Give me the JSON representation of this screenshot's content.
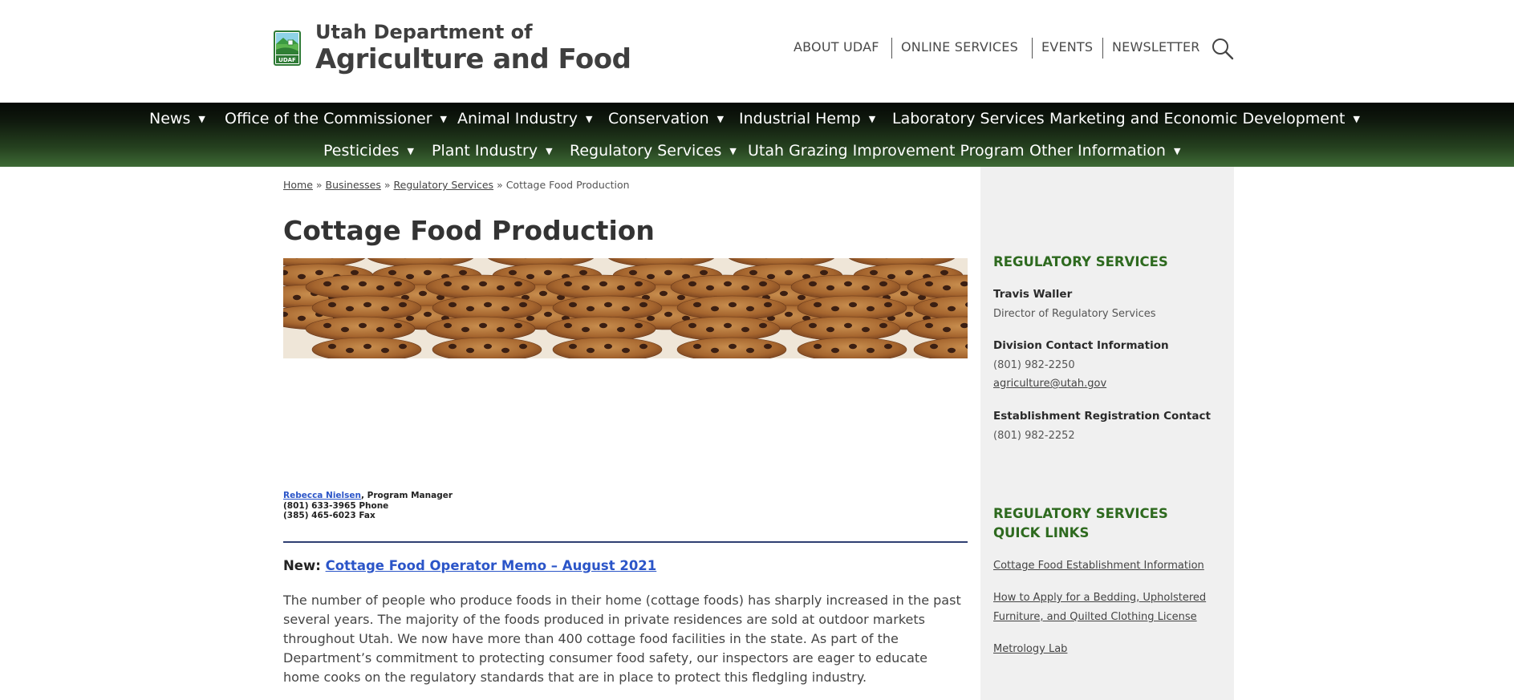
{
  "header": {
    "brand_line1": "Utah Department of",
    "brand_line2": "Agriculture and Food",
    "logo_text": "UDAF",
    "utility_links": [
      "ABOUT UDAF",
      "ONLINE SERVICES",
      "EVENTS",
      "NEWSLETTER"
    ],
    "search_icon": "magnifier"
  },
  "nav": {
    "row1": [
      {
        "label": "News",
        "has_dropdown": true
      },
      {
        "label": "Office of the Commissioner",
        "has_dropdown": true
      },
      {
        "label": "Animal Industry",
        "has_dropdown": true
      },
      {
        "label": "Conservation",
        "has_dropdown": true
      },
      {
        "label": "Industrial Hemp",
        "has_dropdown": true
      },
      {
        "label": "Laboratory Services",
        "has_dropdown": false
      },
      {
        "label": "Marketing and Economic Development",
        "has_dropdown": true
      }
    ],
    "row2": [
      {
        "label": "Pesticides",
        "has_dropdown": true
      },
      {
        "label": "Plant Industry",
        "has_dropdown": true
      },
      {
        "label": "Regulatory Services",
        "has_dropdown": true
      },
      {
        "label": "Utah Grazing Improvement Program",
        "has_dropdown": false
      },
      {
        "label": "Other Information",
        "has_dropdown": true
      }
    ],
    "caret": "▼"
  },
  "breadcrumb": {
    "home": "Home",
    "businesses": "Businesses",
    "regulatory": "Regulatory Services",
    "current": "Cottage Food Production",
    "separator": "»"
  },
  "page": {
    "title": "Cottage Food Production",
    "contact_name": "Rebecca Nielsen",
    "contact_role": ", Program Manager",
    "contact_phone": "(801) 633-3965 Phone",
    "contact_fax": "(385) 465-6023 Fax",
    "memo_prefix": "New:",
    "memo_link": "Cottage Food Operator Memo – August 2021",
    "intro": "The number of people who produce foods in their home (cottage foods) has sharply increased in the past several years. The majority of the foods produced in private residences are sold at outdoor markets throughout Utah. We now have more than 400 cottage food facilities in the state. As part of the Department’s commitment to protecting consumer food safety, our inspectors are eager to educate home cooks on the regulatory standards that are in place to protect this fledgling industry."
  },
  "sidebar": {
    "heading": "REGULATORY SERVICES",
    "director_name": "Travis Waller",
    "director_title": "Director of Regulatory Services",
    "division_label": "Division Contact Information",
    "division_phone": "(801) 982-2250",
    "division_email": "agriculture@utah.gov",
    "registration_label": "Establishment Registration Contact",
    "registration_phone": "(801) 982-2252",
    "quick_links_heading_1": "REGULATORY SERVICES",
    "quick_links_heading_2": "QUICK LINKS",
    "quick_links": [
      "Cottage Food Establishment Information",
      "How to Apply for a Bedding, Upholstered",
      "Furniture, and Quilted Clothing License",
      "Metrology Lab"
    ]
  },
  "colors": {
    "nav_top": "#050805",
    "nav_bottom": "#3d6a35",
    "accent_green": "#2e6a1f",
    "link_blue": "#2b55c8",
    "divider": "#2f3f72",
    "sidebar_bg": "#f0f0f0"
  }
}
